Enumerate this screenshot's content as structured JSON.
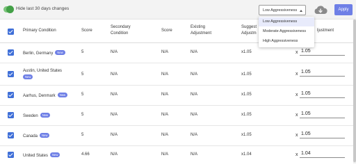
{
  "toolbar": {
    "toggle_label": "Hide last 30 days changes",
    "toggle_on": true,
    "select_value": "Low Aggressiveness",
    "apply_label": "Apply",
    "cloud_icon": "cloud-download-icon"
  },
  "dropdown": {
    "options": [
      "Low Aggressiveness",
      "Moderate Aggressiveness",
      "High Aggressiveness"
    ]
  },
  "table": {
    "headers": {
      "primary": "Primary Condition",
      "score1": "Score",
      "secondary_l1": "Secondary",
      "secondary_l2": "Condition",
      "score2": "Score",
      "existing_l1": "Existing",
      "existing_l2": "Adjustment",
      "suggested_l1": "Suggest",
      "suggested_l2": "Adjustm",
      "adjustment": "ljustment"
    },
    "rows": [
      {
        "condition": "Berlin, Germany",
        "badge": "New",
        "score": "5",
        "secondary": "N/A",
        "score2": "N/A",
        "existing": "N/A",
        "suggested": "x1.05",
        "x": "x",
        "adjustment": "1.05"
      },
      {
        "condition": "Austin, United States",
        "badge": "New",
        "score": "5",
        "secondary": "N/A",
        "score2": "N/A",
        "existing": "N/A",
        "suggested": "x1.05",
        "x": "x",
        "adjustment": "1.05"
      },
      {
        "condition": "Aarhus, Denmark",
        "badge": "New",
        "score": "5",
        "secondary": "N/A",
        "score2": "N/A",
        "existing": "N/A",
        "suggested": "x1.05",
        "x": "x",
        "adjustment": "1.05"
      },
      {
        "condition": "Sweden",
        "badge": "New",
        "score": "5",
        "secondary": "N/A",
        "score2": "N/A",
        "existing": "N/A",
        "suggested": "x1.05",
        "x": "x",
        "adjustment": "1.05"
      },
      {
        "condition": "Canada",
        "badge": "New",
        "score": "5",
        "secondary": "N/A",
        "score2": "N/A",
        "existing": "N/A",
        "suggested": "x1.05",
        "x": "x",
        "adjustment": "1.05"
      },
      {
        "condition": "United States",
        "badge": "New",
        "score": "4.66",
        "secondary": "N/A",
        "score2": "N/A",
        "existing": "N/A",
        "suggested": "x1.04",
        "x": "x",
        "adjustment": "1.04"
      }
    ]
  },
  "colors": {
    "accent": "#6e7fe6",
    "checkbox": "#3f6fd8",
    "toggle": "#43a047"
  }
}
